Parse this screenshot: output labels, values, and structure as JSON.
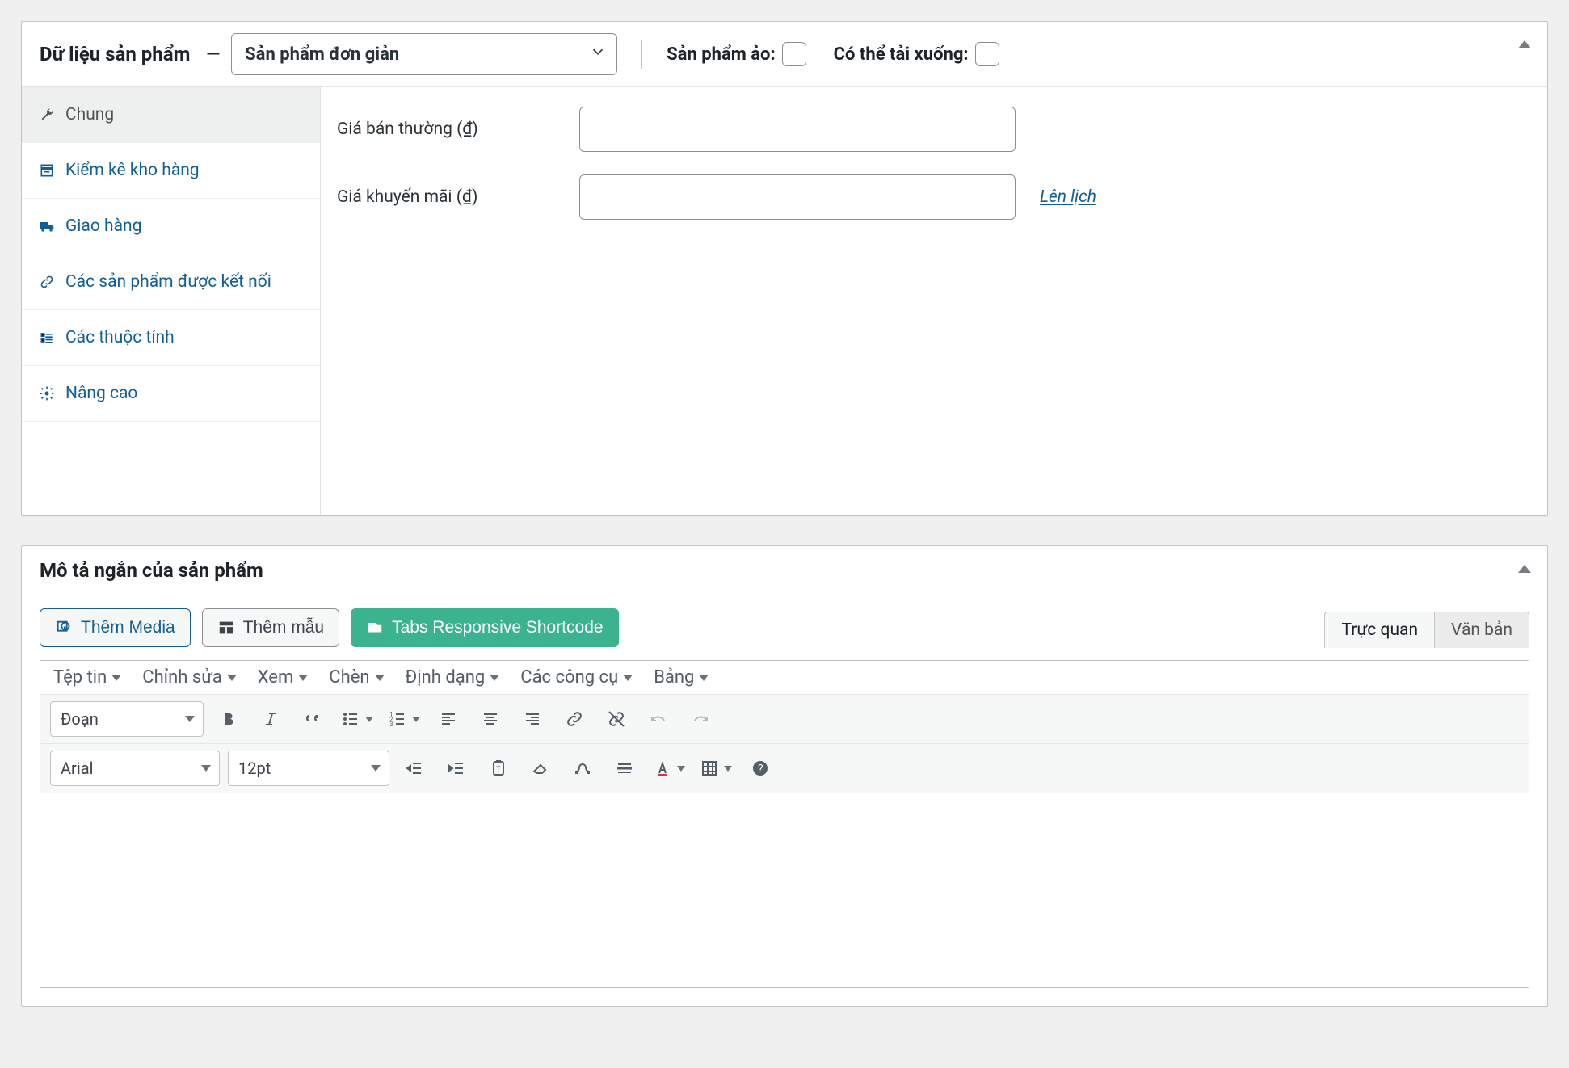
{
  "product_data": {
    "heading": "Dữ liệu sản phẩm",
    "dash": "—",
    "product_type_selected": "Sản phẩm đơn giản",
    "virtual_label": "Sản phẩm ảo:",
    "downloadable_label": "Có thể tải xuống:",
    "virtual_checked": false,
    "downloadable_checked": false,
    "tabs": [
      {
        "id": "general",
        "label": "Chung",
        "icon": "wrench",
        "active": true
      },
      {
        "id": "inventory",
        "label": "Kiểm kê kho hàng",
        "icon": "inventory",
        "active": false
      },
      {
        "id": "shipping",
        "label": "Giao hàng",
        "icon": "truck",
        "active": false
      },
      {
        "id": "linked",
        "label": "Các sản phẩm được kết nối",
        "icon": "link",
        "active": false
      },
      {
        "id": "attrs",
        "label": "Các thuộc tính",
        "icon": "list",
        "active": false
      },
      {
        "id": "advanced",
        "label": "Nâng cao",
        "icon": "gear",
        "active": false
      }
    ],
    "general_panel": {
      "regular_price_label": "Giá bán thường (₫)",
      "regular_price_value": "",
      "sale_price_label": "Giá khuyến mãi (₫)",
      "sale_price_value": "",
      "schedule_link": "Lên lịch"
    }
  },
  "short_description": {
    "heading": "Mô tả ngắn của sản phẩm",
    "buttons": {
      "add_media": "Thêm Media",
      "add_template": "Thêm mẫu",
      "tabs_shortcode": "Tabs Responsive Shortcode"
    },
    "editor_tabs": {
      "visual": "Trực quan",
      "text": "Văn bản",
      "active": "visual"
    },
    "menubar": [
      "Tệp tin",
      "Chỉnh sửa",
      "Xem",
      "Chèn",
      "Định dạng",
      "Các công cụ",
      "Bảng"
    ],
    "toolbar1": {
      "format_select": "Đoạn",
      "buttons": [
        {
          "id": "bold",
          "icon": "bold"
        },
        {
          "id": "italic",
          "icon": "italic"
        },
        {
          "id": "blockquote",
          "icon": "quote"
        },
        {
          "id": "bullist",
          "icon": "ul",
          "dropdown": true
        },
        {
          "id": "numlist",
          "icon": "ol",
          "dropdown": true
        },
        {
          "id": "alignleft",
          "icon": "al"
        },
        {
          "id": "aligncenter",
          "icon": "ac"
        },
        {
          "id": "alignright",
          "icon": "ar"
        },
        {
          "id": "link",
          "icon": "link"
        },
        {
          "id": "unlink",
          "icon": "unlink"
        },
        {
          "id": "undo",
          "icon": "undo",
          "disabled": true
        },
        {
          "id": "redo",
          "icon": "redo",
          "disabled": true
        }
      ]
    },
    "toolbar2": {
      "font_select": "Arial",
      "size_select": "12pt",
      "buttons": [
        {
          "id": "outdent",
          "icon": "outdent"
        },
        {
          "id": "indent",
          "icon": "indent"
        },
        {
          "id": "paste",
          "icon": "paste"
        },
        {
          "id": "clear",
          "icon": "eraser"
        },
        {
          "id": "charmap",
          "icon": "omega"
        },
        {
          "id": "hr",
          "icon": "hr"
        },
        {
          "id": "forecolor",
          "icon": "textcolor",
          "dropdown": true
        },
        {
          "id": "table",
          "icon": "table",
          "dropdown": true
        },
        {
          "id": "help",
          "icon": "help"
        }
      ]
    }
  }
}
